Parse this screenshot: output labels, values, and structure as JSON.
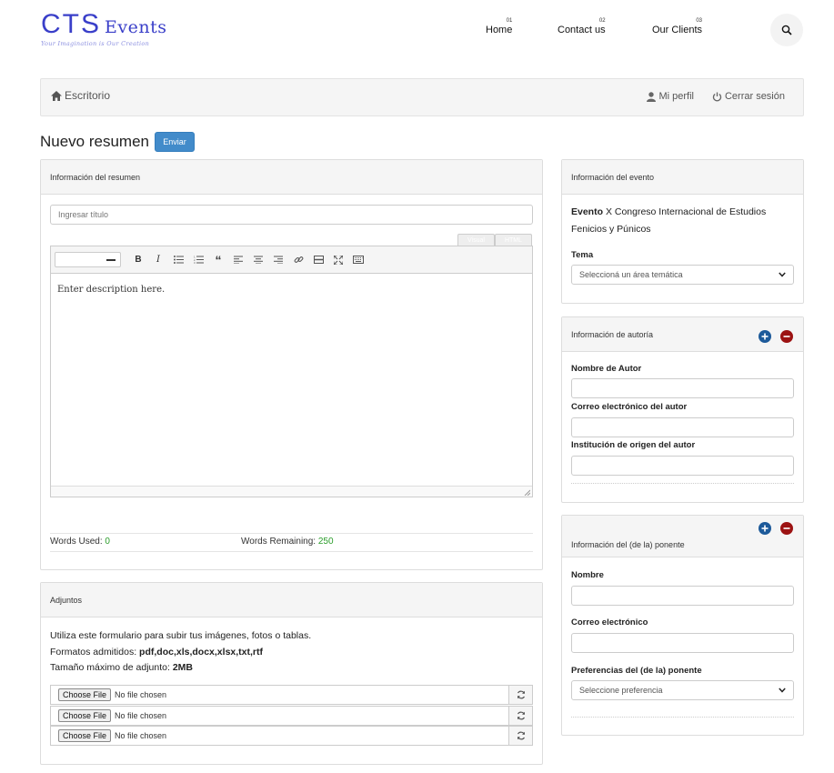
{
  "logo": {
    "main": "CTS",
    "sub": "Events",
    "tagline": "Your Imagination is Our Creation"
  },
  "nav": [
    {
      "num": "01",
      "label": "Home"
    },
    {
      "num": "02",
      "label": "Contact us"
    },
    {
      "num": "03",
      "label": "Our Clients"
    }
  ],
  "breadcrumb": {
    "home": "Escritorio",
    "profile": "Mi perfil",
    "logout": "Cerrar sesión"
  },
  "page": {
    "title": "Nuevo resumen",
    "send_label": "Enviar"
  },
  "summary_panel": {
    "header": "Información del resumen",
    "title_placeholder": "Ingresar título",
    "tabs": [
      "Visual",
      "HTML"
    ],
    "editor_text": "Enter description here.",
    "words_used_label": "Words Used:",
    "words_used": "0",
    "words_remaining_label": "Words Remaining:",
    "words_remaining": "250"
  },
  "attachments": {
    "header": "Adjuntos",
    "line1": "Utiliza este formulario para subir tus imágenes, fotos o tablas.",
    "formats_label": "Formatos admitidos:",
    "formats": "pdf,doc,xls,docx,xlsx,txt,rtf",
    "maxsize_label": "Tamaño máximo de adjunto:",
    "maxsize": "2MB",
    "files": [
      {
        "button": "Choose File",
        "status": "No file chosen"
      },
      {
        "button": "Choose File",
        "status": "No file chosen"
      },
      {
        "button": "Choose File",
        "status": "No file chosen"
      }
    ]
  },
  "event_panel": {
    "header": "Información del evento",
    "event_label": "Evento",
    "event_name": "X Congreso Internacional de Estudios Fenicios y Púnicos",
    "tema_label": "Tema",
    "tema_select": "Seleccioná un área temática"
  },
  "author_panel": {
    "header": "Información de autoría",
    "name_label": "Nombre de Autor",
    "email_label": "Correo electrónico del autor",
    "institution_label": "Institución de origen del autor"
  },
  "speaker_panel": {
    "header": "Información del (de la) ponente",
    "name_label": "Nombre",
    "email_label": "Correo electrónico",
    "prefs_label": "Preferencias del (de la) ponente",
    "prefs_select": "Seleccione preferencia"
  },
  "colors": {
    "logo": "#3a3fc9",
    "primary_button": "#428bca",
    "counter_green": "#2a9d2a",
    "add_circle": "#1d5a9a",
    "remove_circle": "#9c1212"
  }
}
